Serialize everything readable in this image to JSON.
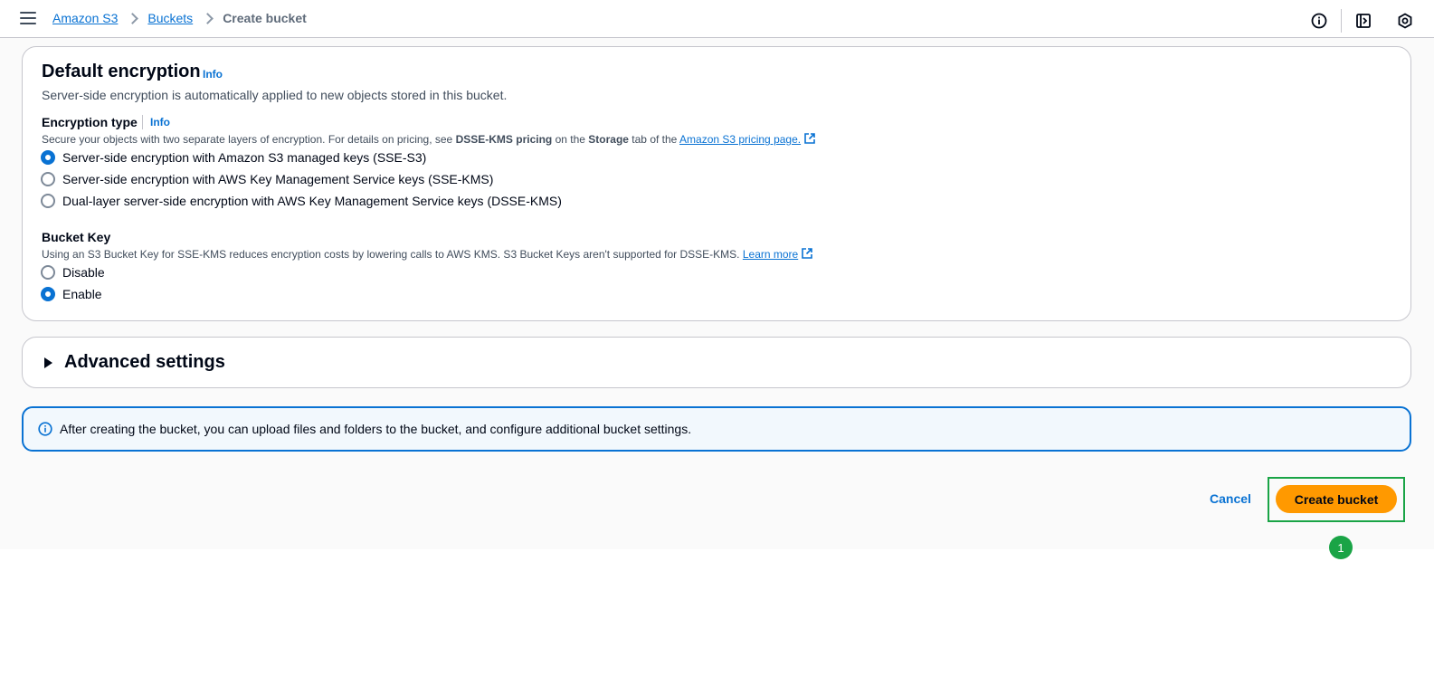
{
  "breadcrumb": {
    "items": [
      "Amazon S3",
      "Buckets"
    ],
    "current": "Create bucket"
  },
  "top_icons": [
    "info-icon",
    "feedback-panel-icon",
    "settings-hex-icon"
  ],
  "encryption": {
    "title": "Default encryption",
    "info": "Info",
    "description": "Server-side encryption is automatically applied to new objects stored in this bucket.",
    "type_label": "Encryption type",
    "type_info": "Info",
    "type_desc_prefix": "Secure your objects with two separate layers of encryption. For details on pricing, see ",
    "type_desc_bold1": "DSSE-KMS pricing",
    "type_desc_mid": " on the ",
    "type_desc_bold2": "Storage",
    "type_desc_suffix": " tab of the ",
    "type_desc_link": "Amazon S3 pricing page.",
    "options": [
      {
        "label": "Server-side encryption with Amazon S3 managed keys (SSE-S3)",
        "checked": true
      },
      {
        "label": "Server-side encryption with AWS Key Management Service keys (SSE-KMS)",
        "checked": false
      },
      {
        "label": "Dual-layer server-side encryption with AWS Key Management Service keys (DSSE-KMS)",
        "checked": false
      }
    ],
    "bucket_key_label": "Bucket Key",
    "bucket_key_desc": "Using an S3 Bucket Key for SSE-KMS reduces encryption costs by lowering calls to AWS KMS. S3 Bucket Keys aren't supported for DSSE-KMS. ",
    "bucket_key_link": "Learn more",
    "bucket_key_options": [
      {
        "label": "Disable",
        "checked": false
      },
      {
        "label": "Enable",
        "checked": true
      }
    ]
  },
  "advanced": {
    "title": "Advanced settings"
  },
  "alert": {
    "text": "After creating the bucket, you can upload files and folders to the bucket, and configure additional bucket settings."
  },
  "actions": {
    "cancel": "Cancel",
    "create": "Create bucket"
  },
  "annotation": {
    "step": "1"
  },
  "colors": {
    "accent": "#0972d3",
    "primary_button": "#ff9900",
    "highlight": "#1aa446"
  }
}
